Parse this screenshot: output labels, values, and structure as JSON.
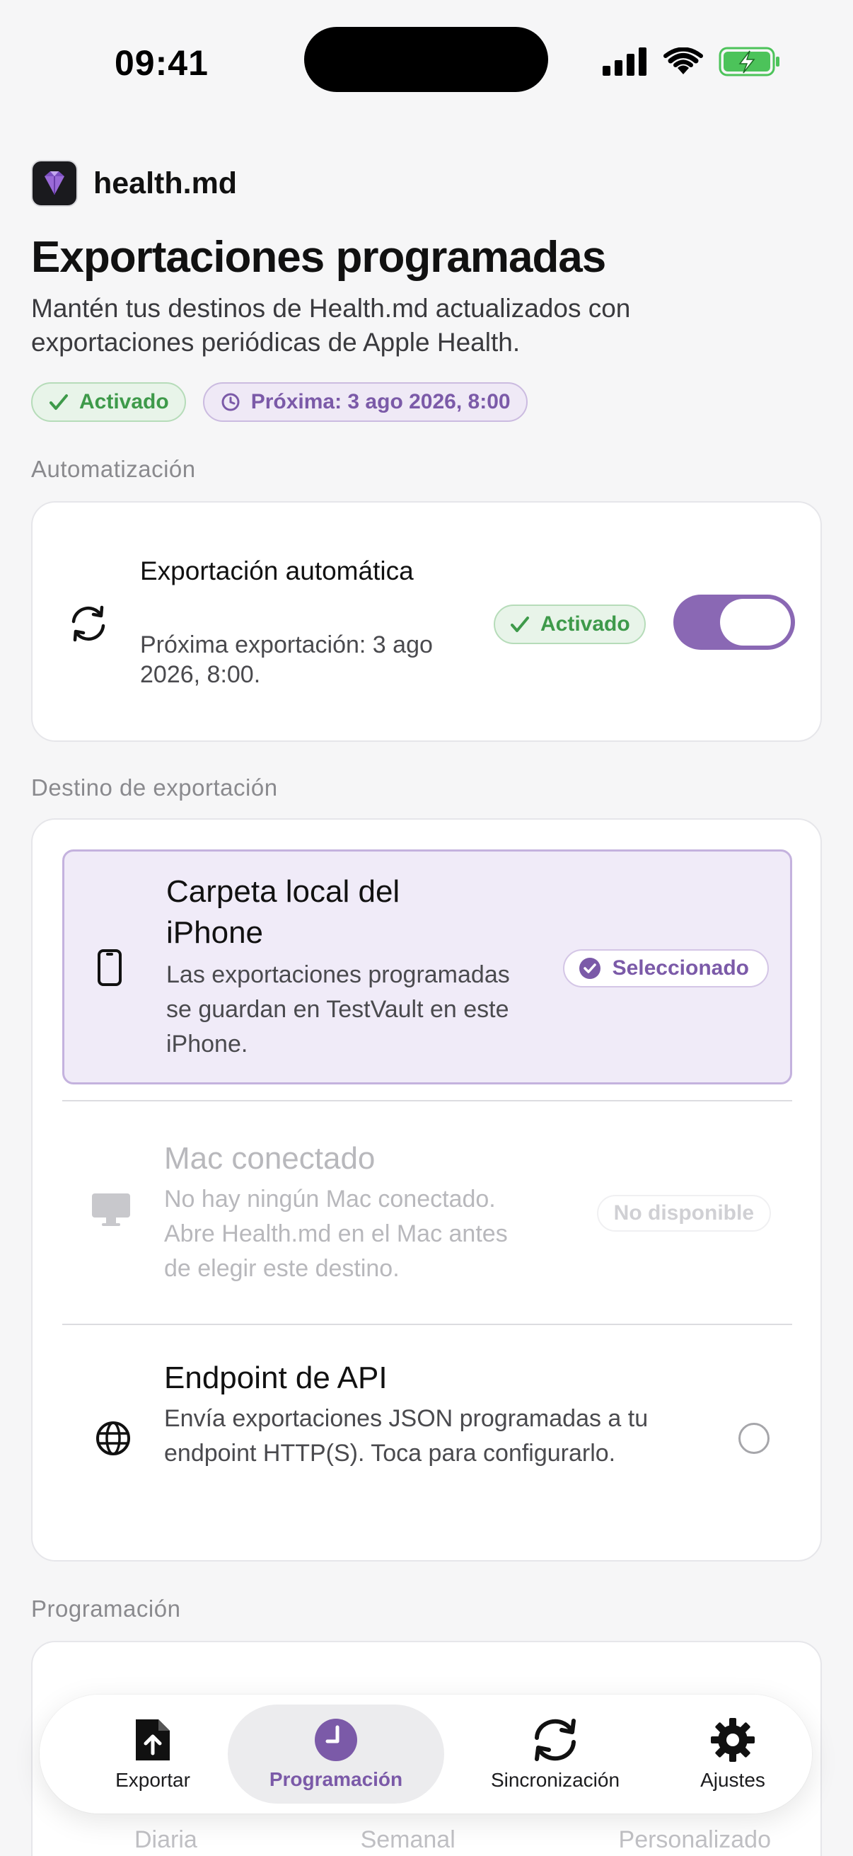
{
  "status_bar": {
    "time": "09:41"
  },
  "app": {
    "name": "health.md"
  },
  "header": {
    "title": "Exportaciones programadas",
    "subtitle": "Mantén tus destinos de Health.md actualizados con exportaciones periódicas de Apple Health."
  },
  "chips": {
    "enabled": "Activado",
    "next": "Próxima: 3 ago 2026, 8:00"
  },
  "automation": {
    "section_label": "Automatización",
    "title": "Exportación automática",
    "description": "Próxima exportación: 3 ago 2026, 8:00.",
    "status": "Activado",
    "toggle_on": true
  },
  "destination": {
    "section_label": "Destino de exportación",
    "options": [
      {
        "title": "Carpeta local del iPhone",
        "description": "Las exportaciones programadas se guardan en TestVault en este iPhone.",
        "badge": "Seleccionado",
        "icon": "iphone-icon",
        "state": "selected"
      },
      {
        "title": "Mac conectado",
        "description": "No hay ningún Mac conectado. Abre Health.md en el Mac antes de elegir este destino.",
        "badge": "No disponible",
        "icon": "desktop-icon",
        "state": "disabled"
      },
      {
        "title": "Endpoint de API",
        "description": "Envía exportaciones JSON programadas a tu endpoint HTTP(S). Toca para configurarlo.",
        "icon": "globe-icon",
        "state": "unselected"
      }
    ]
  },
  "schedule": {
    "section_label": "Programación",
    "segments": [
      "Diaria",
      "Semanal",
      "Personalizado"
    ]
  },
  "tabbar": {
    "tabs": [
      {
        "label": "Exportar",
        "icon": "export-doc-icon"
      },
      {
        "label": "Programación",
        "icon": "clock-icon",
        "active": true
      },
      {
        "label": "Sincronización",
        "icon": "sync-icon"
      },
      {
        "label": "Ajustes",
        "icon": "gear-icon"
      }
    ]
  },
  "colors": {
    "accent": "#8a68b4",
    "success": "#3e9a4a"
  }
}
